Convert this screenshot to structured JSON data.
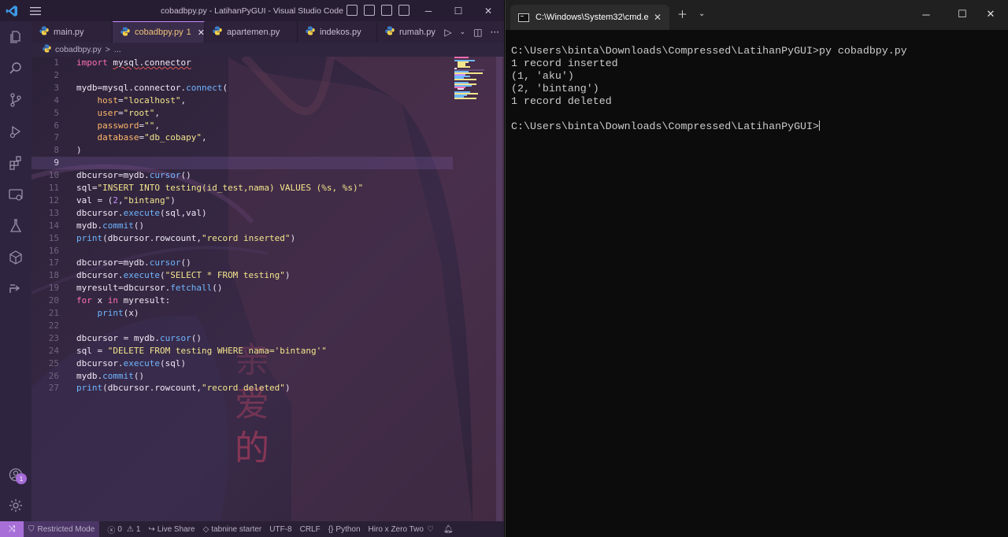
{
  "vscode": {
    "title": "cobadbpy.py - LatihanPyGUI - Visual Studio Code",
    "tabs": [
      {
        "label": "main.py",
        "active": false
      },
      {
        "label": "cobadbpy.py",
        "active": true,
        "dirty": "1"
      },
      {
        "label": "apartemen.py",
        "active": false
      },
      {
        "label": "indekos.py",
        "active": false
      },
      {
        "label": "rumah.py",
        "active": false
      }
    ],
    "breadcrumb": {
      "file": "cobadbpy.py",
      "sep": ">",
      "ellipsis": "..."
    },
    "code_lines": [
      "import mysql.connector",
      "",
      "mydb=mysql.connector.connect(",
      "    host=\"localhost\",",
      "    user=\"root\",",
      "    password=\"\",",
      "    database=\"db_cobapy\",",
      ")",
      "",
      "dbcursor=mydb.cursor()",
      "sql=\"INSERT INTO testing(id_test,nama) VALUES (%s, %s)\"",
      "val = (2,\"bintang\")",
      "dbcursor.execute(sql,val)",
      "mydb.commit()",
      "print(dbcursor.rowcount,\"record inserted\")",
      "",
      "dbcursor=mydb.cursor()",
      "dbcursor.execute(\"SELECT * FROM testing\")",
      "myresult=dbcursor.fetchall()",
      "for x in myresult:",
      "    print(x)",
      "",
      "dbcursor = mydb.cursor()",
      "sql = \"DELETE FROM testing WHERE nama='bintang'\"",
      "dbcursor.execute(sql)",
      "mydb.commit()",
      "print(dbcursor.rowcount,\"record deleted\")"
    ],
    "current_line": 9,
    "accounts_badge": "1",
    "status": {
      "restricted": "Restricted Mode",
      "errors": "0",
      "warnings": "1",
      "live_share": "Live Share",
      "tabnine": "tabnine starter",
      "encoding": "UTF-8",
      "eol": "CRLF",
      "language": "Python",
      "theme": "Hiro x Zero Two"
    },
    "colors": {
      "accent": "#a86fd9",
      "keyword": "#ff6fb4",
      "function": "#6fb6ff",
      "string": "#f3e58c",
      "number": "#c791ff",
      "param": "#ffb86c"
    }
  },
  "terminal": {
    "tab_title": "C:\\Windows\\System32\\cmd.e",
    "lines": [
      "C:\\Users\\binta\\Downloads\\Compressed\\LatihanPyGUI>py cobadbpy.py",
      "1 record inserted",
      "(1, 'aku')",
      "(2, 'bintang')",
      "1 record deleted",
      "",
      "C:\\Users\\binta\\Downloads\\Compressed\\LatihanPyGUI>"
    ]
  }
}
